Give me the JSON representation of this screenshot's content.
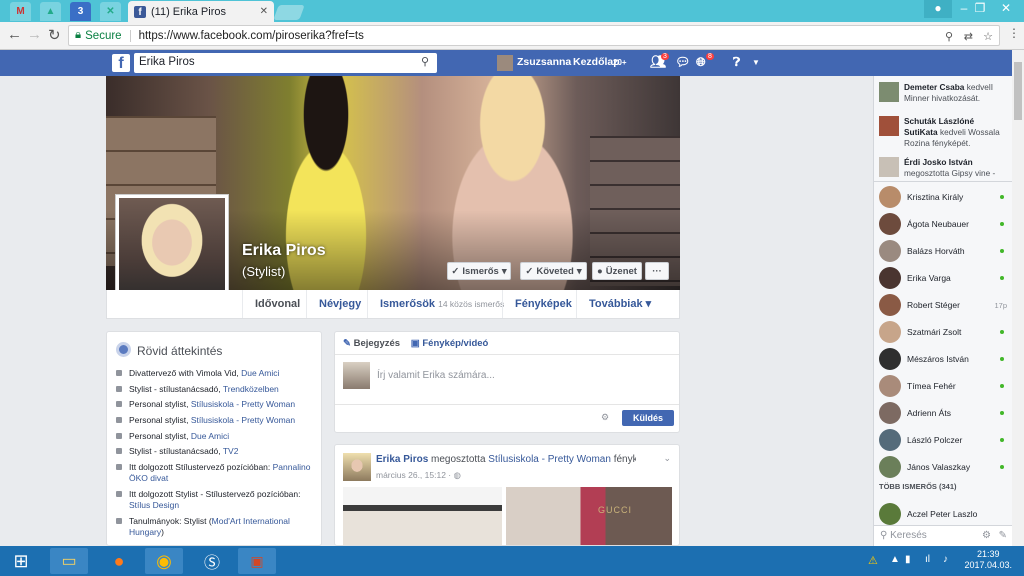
{
  "browser": {
    "pinned_tabs": [
      "M",
      "▲",
      "3",
      "✕"
    ],
    "active_tab_title": "(11) Erika Piros",
    "url": "https://www.facebook.com/piroserika?fref=ts",
    "secure_label": "Secure"
  },
  "fb": {
    "search_value": "Erika Piros",
    "user_name": "Zsuzsanna",
    "home_label": "Kezdőlap",
    "home_count": "20+",
    "friend_badge": "3",
    "notif_badge": "8"
  },
  "profile": {
    "name": "Erika Piros",
    "job": "(Stylist)",
    "btn_friends": "Ismerős",
    "btn_follow": "Követed",
    "btn_message": "Üzenet",
    "btn_more": "···",
    "tabs": {
      "timeline": "Idővonal",
      "about": "Névjegy",
      "friends": "Ismerősök",
      "friends_sub": "14 közös ismerős",
      "photos": "Fényképek",
      "more": "Továbbiak"
    }
  },
  "intro": {
    "title": "Rövid áttekintés",
    "items": [
      {
        "text": "Divattervező with Vimola Vid, ",
        "link": "Due Amici"
      },
      {
        "text": "Stylist - stílustanácsadó, ",
        "link": "Trendközelben"
      },
      {
        "text": "Personal stylist, ",
        "link": "Stílusiskola - Pretty Woman"
      },
      {
        "text": "Personal stylist, ",
        "link": "Stílusiskola - Pretty Woman"
      },
      {
        "text": "Personal stylist, ",
        "link": "Due Amici"
      },
      {
        "text": "Stylist - stílustanácsadó, ",
        "link": "TV2"
      },
      {
        "text": "Itt dolgozott Stílustervező pozícióban: ",
        "link": "Pannalino ÖKO divat"
      },
      {
        "text": "Itt dolgozott Stylist - Stílustervező pozícióban: ",
        "link": "Stílus Design"
      },
      {
        "text": "Tanulmányok: Stylist (",
        "link": "Mod'Art International Hungary",
        "tail": ")"
      }
    ]
  },
  "composer": {
    "tab_post": "Bejegyzés",
    "tab_photo": "Fénykép/videó",
    "placeholder": "Írj valamit Erika számára...",
    "send": "Küldés"
  },
  "post": {
    "author": "Erika Piros",
    "shared": " megosztotta ",
    "page": "Stílusiskola - Pretty Woman",
    "suffix": " fényképét.",
    "date": "március 26., 15:12 · ",
    "img_text": "GUCCI"
  },
  "ticker": [
    {
      "name": "Demeter Csaba",
      "text": " kedvelI Minner hivatkozását."
    },
    {
      "name": "Schuták Lászlóné SutiKata",
      "text": " kedveli Wossala Rozina fényképét."
    },
    {
      "name": "Érdi Josko István",
      "text": " megosztotta Gipsy vine -"
    }
  ],
  "chat": [
    {
      "name": "Krisztina Király",
      "status": "online"
    },
    {
      "name": "Ágota Neubauer",
      "status": "online"
    },
    {
      "name": "Balázs Horváth",
      "status": "online"
    },
    {
      "name": "Erika Varga",
      "status": "online"
    },
    {
      "name": "Robert Stéger",
      "status": "17p"
    },
    {
      "name": "Szatmári Zsolt",
      "status": "online"
    },
    {
      "name": "Mészáros István",
      "status": "online"
    },
    {
      "name": "Tímea Fehér",
      "status": "online"
    },
    {
      "name": "Adrienn Áts",
      "status": "online"
    },
    {
      "name": "László Polczer",
      "status": "online"
    },
    {
      "name": "János Valaszkay",
      "status": "online"
    }
  ],
  "more_friends": "TÖBB ISMERŐS (341)",
  "more_friend_1": "Aczel Peter Laszlo",
  "chat_search": "Keresés",
  "taskbar": {
    "time": "21:39",
    "date": "2017.04.03."
  },
  "colors": {
    "fb_blue": "#4267b2",
    "link": "#365899",
    "online": "#42b72a"
  }
}
